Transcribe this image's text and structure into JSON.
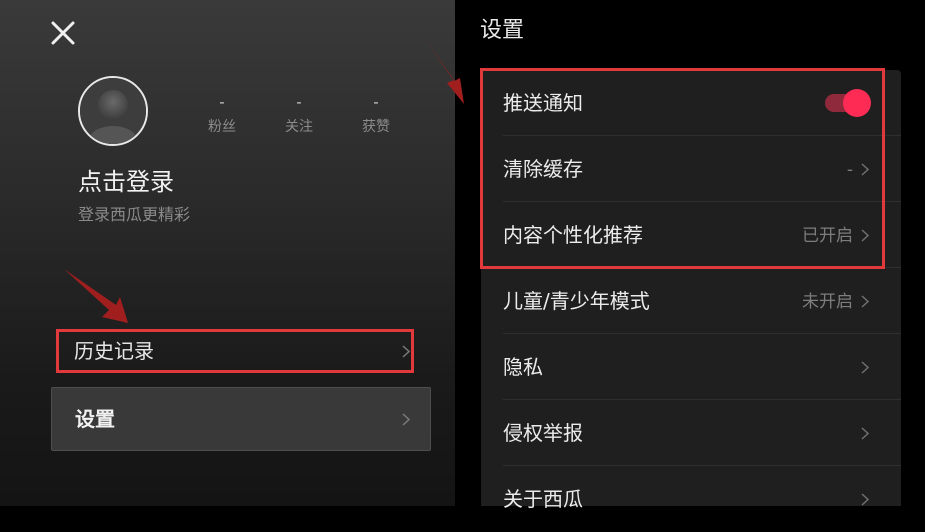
{
  "left_panel": {
    "close_icon": "close-icon",
    "avatar_icon": "avatar-placeholder-icon",
    "stats": [
      {
        "value": "-",
        "label": "粉丝"
      },
      {
        "value": "-",
        "label": "关注"
      },
      {
        "value": "-",
        "label": "获赞"
      }
    ],
    "login_title": "点击登录",
    "login_subtitle": "登录西瓜更精彩",
    "history_label": "历史记录",
    "settings_label": "设置"
  },
  "settings_page": {
    "title": "设置",
    "items": [
      {
        "label": "推送通知",
        "toggle_on": true
      },
      {
        "label": "清除缓存",
        "value": "-"
      },
      {
        "label": "内容个性化推荐",
        "value": "已开启"
      },
      {
        "label": "儿童/青少年模式",
        "value": "未开启"
      },
      {
        "label": "隐私",
        "value": ""
      },
      {
        "label": "侵权举报",
        "value": ""
      },
      {
        "label": "关于西瓜",
        "value": ""
      }
    ]
  },
  "colors": {
    "accent": "#fe2c55",
    "highlight": "#e23a3c",
    "annotation_arrow": "#a01e1e"
  }
}
